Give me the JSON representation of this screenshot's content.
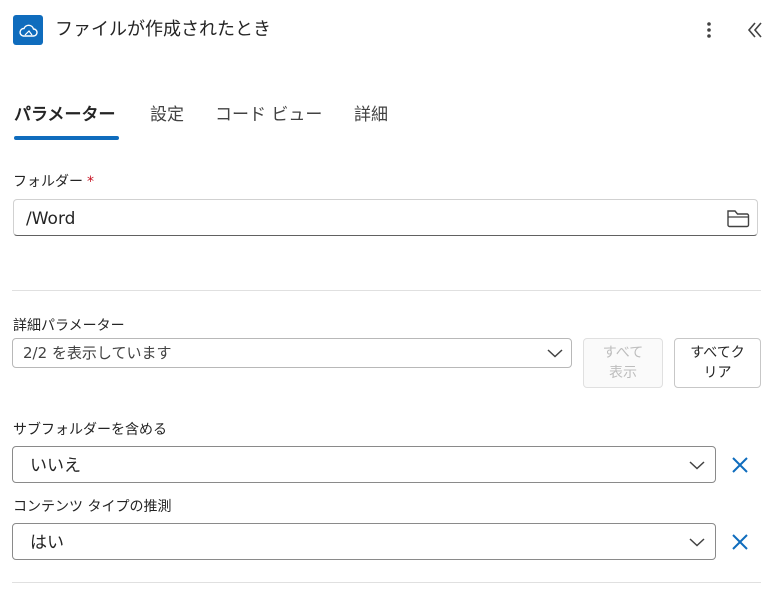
{
  "header": {
    "title": "ファイルが作成されたとき",
    "icon": "onedrive-cloud-icon",
    "accent": "#0f6cbd"
  },
  "tabs": [
    {
      "label": "パラメーター",
      "active": true
    },
    {
      "label": "設定",
      "active": false
    },
    {
      "label": "コード ビュー",
      "active": false
    },
    {
      "label": "詳細",
      "active": false
    }
  ],
  "folder": {
    "label": "フォルダー",
    "required_mark": "*",
    "value": "/Word"
  },
  "advanced": {
    "label": "詳細パラメーター",
    "value": "2/2 を表示しています",
    "show_all_label": "すべて\n表示",
    "clear_all_label": "すべてク\nリア"
  },
  "subfolders": {
    "label": "サブフォルダーを含める",
    "value": "いいえ"
  },
  "content_type": {
    "label": "コンテンツ タイプの推測",
    "value": "はい"
  }
}
